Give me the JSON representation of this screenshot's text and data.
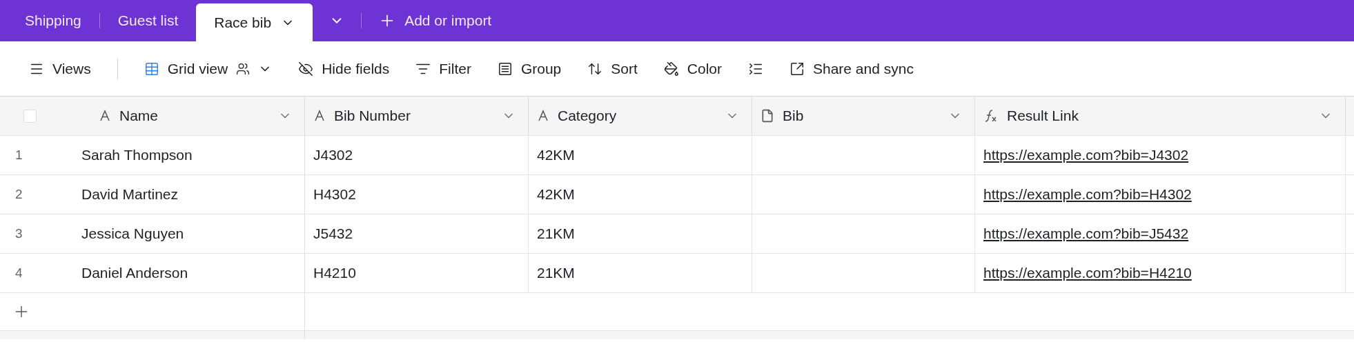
{
  "tabs": [
    {
      "label": "Shipping",
      "selected": false
    },
    {
      "label": "Guest list",
      "selected": false
    },
    {
      "label": "Race bib",
      "selected": true
    }
  ],
  "add_button": {
    "label": "Add or import"
  },
  "toolbar": [
    {
      "kind": "views",
      "label": "Views"
    },
    {
      "kind": "grid",
      "label": "Grid view"
    },
    {
      "kind": "hide",
      "label": "Hide fields"
    },
    {
      "kind": "filter",
      "label": "Filter"
    },
    {
      "kind": "group",
      "label": "Group"
    },
    {
      "kind": "sort",
      "label": "Sort"
    },
    {
      "kind": "color",
      "label": "Color"
    },
    {
      "kind": "height"
    },
    {
      "kind": "share",
      "label": "Share and sync"
    }
  ],
  "table": {
    "select_all_checked": false,
    "columns": [
      {
        "label": "Name",
        "kind": "text"
      },
      {
        "label": "Bib Number",
        "kind": "text"
      },
      {
        "label": "Category",
        "kind": "text"
      },
      {
        "label": "Bib",
        "kind": "attachment"
      },
      {
        "label": "Result Link",
        "kind": "formula"
      }
    ],
    "rows": [
      {
        "number": "1",
        "cells": [
          "Sarah Thompson",
          "J4302",
          "42KM",
          "",
          "https://example.com?bib=J4302"
        ]
      },
      {
        "number": "2",
        "cells": [
          "David Martinez",
          "H4302",
          "42KM",
          "",
          "https://example.com?bib=H4302"
        ]
      },
      {
        "number": "3",
        "cells": [
          "Jessica Nguyen",
          "J5432",
          "21KM",
          "",
          "https://example.com?bib=J5432"
        ]
      },
      {
        "number": "4",
        "cells": [
          "Daniel Anderson",
          "H4210",
          "21KM",
          "",
          "https://example.com?bib=H4210"
        ]
      }
    ]
  }
}
